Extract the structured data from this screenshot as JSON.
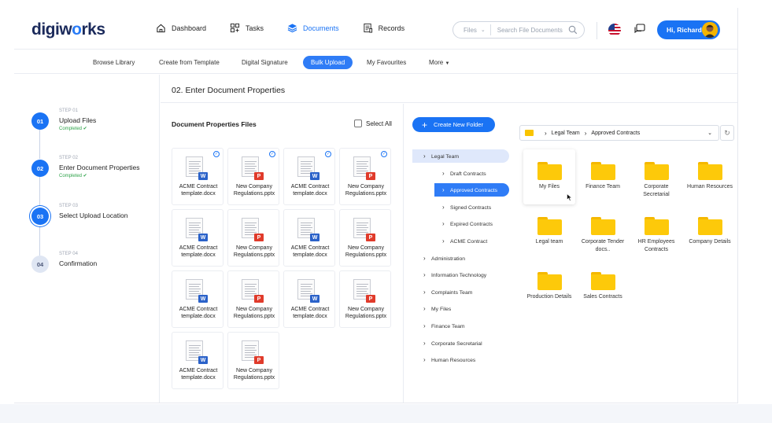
{
  "app": {
    "logo": {
      "part1": "digiw",
      "accent": "o",
      "part2": "rks"
    },
    "nav": [
      {
        "label": "Dashboard",
        "icon": "home-icon"
      },
      {
        "label": "Tasks",
        "icon": "tasks-icon"
      },
      {
        "label": "Documents",
        "icon": "layers-icon",
        "active": true
      },
      {
        "label": "Records",
        "icon": "records-icon"
      }
    ],
    "search": {
      "filter": "Files",
      "placeholder": "Search File Documents"
    },
    "greeting": "Hi, Richard",
    "accent_color": "#1a73f4"
  },
  "subnav": [
    {
      "label": "Browse Library"
    },
    {
      "label": "Create from Template"
    },
    {
      "label": "Digital Signature"
    },
    {
      "label": "Bulk Upload",
      "active": true
    },
    {
      "label": "My Favourites"
    },
    {
      "label": "More"
    }
  ],
  "steps": [
    {
      "num": "01",
      "label": "STEP 01",
      "title": "Upload Files",
      "status": "Completed ✔",
      "state": "done"
    },
    {
      "num": "02",
      "label": "STEP 02",
      "title": "Enter Document Properties",
      "status": "Completed ✔",
      "state": "done"
    },
    {
      "num": "03",
      "label": "STEP 03",
      "title": "Select Upload Location",
      "status": "",
      "state": "current"
    },
    {
      "num": "04",
      "label": "STEP 04",
      "title": "Confirmation",
      "status": "",
      "state": "todo"
    }
  ],
  "main": {
    "title": "02. Enter Document Properties",
    "files_header": "Document Properties Files",
    "select_all": "Select All",
    "files": [
      {
        "line1": "ACME Contract",
        "line2": "template.docx",
        "type": "W",
        "checked": true
      },
      {
        "line1": "New Company",
        "line2": "Regulations.pptx",
        "type": "P",
        "checked": true
      },
      {
        "line1": "ACME Contract",
        "line2": "template.docx",
        "type": "W",
        "checked": true
      },
      {
        "line1": "New Company",
        "line2": "Regulations.pptx",
        "type": "P",
        "checked": true
      },
      {
        "line1": "ACME Contract",
        "line2": "template.docx",
        "type": "W",
        "checked": false
      },
      {
        "line1": "New Company",
        "line2": "Regulations.pptx",
        "type": "P",
        "checked": false
      },
      {
        "line1": "ACME Contract",
        "line2": "template.docx",
        "type": "W",
        "checked": false
      },
      {
        "line1": "New Company",
        "line2": "Regulations.pptx",
        "type": "P",
        "checked": false
      },
      {
        "line1": "ACME Contract",
        "line2": "template.docx",
        "type": "W",
        "checked": false
      },
      {
        "line1": "New Company",
        "line2": "Regulations.pptx",
        "type": "P",
        "checked": false
      },
      {
        "line1": "ACME Contract",
        "line2": "template.docx",
        "type": "W",
        "checked": false
      },
      {
        "line1": "New Company",
        "line2": "Regulations.pptx",
        "type": "P",
        "checked": false
      },
      {
        "line1": "ACME Contract",
        "line2": "template.docx",
        "type": "W",
        "checked": false
      },
      {
        "line1": "New Company",
        "line2": "Regulations.pptx",
        "type": "P",
        "checked": false
      }
    ]
  },
  "tree": {
    "new_folder": "Create New Folder",
    "nodes": [
      {
        "label": "Legal Team",
        "level": 0,
        "state": "highlight"
      },
      {
        "label": "Draft Contracts",
        "level": 1,
        "state": ""
      },
      {
        "label": "Approved Contracts",
        "level": 1,
        "state": "selected"
      },
      {
        "label": "Signed Contracts",
        "level": 1,
        "state": ""
      },
      {
        "label": "Expired Contracts",
        "level": 1,
        "state": ""
      },
      {
        "label": "ACME Contract",
        "level": 1,
        "state": ""
      },
      {
        "label": "Administration",
        "level": 0,
        "state": ""
      },
      {
        "label": "Information Technology",
        "level": 0,
        "state": ""
      },
      {
        "label": "Complaints Team",
        "level": 0,
        "state": ""
      },
      {
        "label": "My Files",
        "level": 0,
        "state": ""
      },
      {
        "label": "Finance Team",
        "level": 0,
        "state": ""
      },
      {
        "label": "Corporate Secretarial",
        "level": 0,
        "state": ""
      },
      {
        "label": "Human Resources",
        "level": 0,
        "state": ""
      }
    ]
  },
  "location": {
    "crumb": [
      "Legal Team",
      "Approved Contracts"
    ],
    "folders": [
      {
        "name": "My Files",
        "hover": true
      },
      {
        "name": "Finance Team"
      },
      {
        "name": "Corporate Secretarial"
      },
      {
        "name": "Human Resources"
      },
      {
        "name": "Legal team"
      },
      {
        "name": "Corporate Tender docs.."
      },
      {
        "name": "HR Employees Contracts"
      },
      {
        "name": "Company Details"
      },
      {
        "name": "Production Details"
      },
      {
        "name": "Sales Contracts"
      }
    ]
  }
}
